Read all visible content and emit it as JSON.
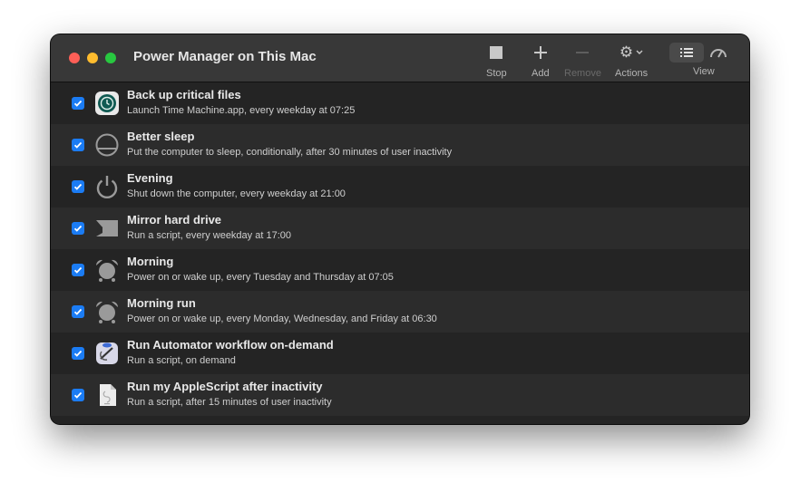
{
  "window": {
    "title": "Power Manager on This Mac"
  },
  "toolbar": {
    "stop_label": "Stop",
    "add_label": "Add",
    "remove_label": "Remove",
    "actions_label": "Actions",
    "view_label": "View"
  },
  "colors": {
    "checkbox": "#1b7cf4",
    "close": "#fe5f57",
    "minimize": "#febc2e",
    "maximize": "#28c840"
  },
  "events": [
    {
      "title": "Back up critical files",
      "subtitle": "Launch Time Machine.app, every weekday at 07:25",
      "icon": "time-machine-icon",
      "enabled": true
    },
    {
      "title": "Better sleep",
      "subtitle": "Put the computer to sleep, conditionally, after 30 minutes of user inactivity",
      "icon": "sleep-icon",
      "enabled": true
    },
    {
      "title": "Evening",
      "subtitle": "Shut down the computer, every weekday at 21:00",
      "icon": "power-icon",
      "enabled": true
    },
    {
      "title": "Mirror hard drive",
      "subtitle": "Run a script, every weekday at 17:00",
      "icon": "script-icon",
      "enabled": true
    },
    {
      "title": "Morning",
      "subtitle": "Power on or wake up, every Tuesday and Thursday at 07:05",
      "icon": "alarm-clock-icon",
      "enabled": true
    },
    {
      "title": "Morning run",
      "subtitle": "Power on or wake up, every Monday, Wednesday, and Friday at 06:30",
      "icon": "alarm-clock-icon",
      "enabled": true
    },
    {
      "title": "Run Automator workflow on-demand",
      "subtitle": "Run a script, on demand",
      "icon": "automator-icon",
      "enabled": true
    },
    {
      "title": "Run my AppleScript after inactivity",
      "subtitle": "Run a script, after 15 minutes of user inactivity",
      "icon": "applescript-document-icon",
      "enabled": true
    }
  ]
}
